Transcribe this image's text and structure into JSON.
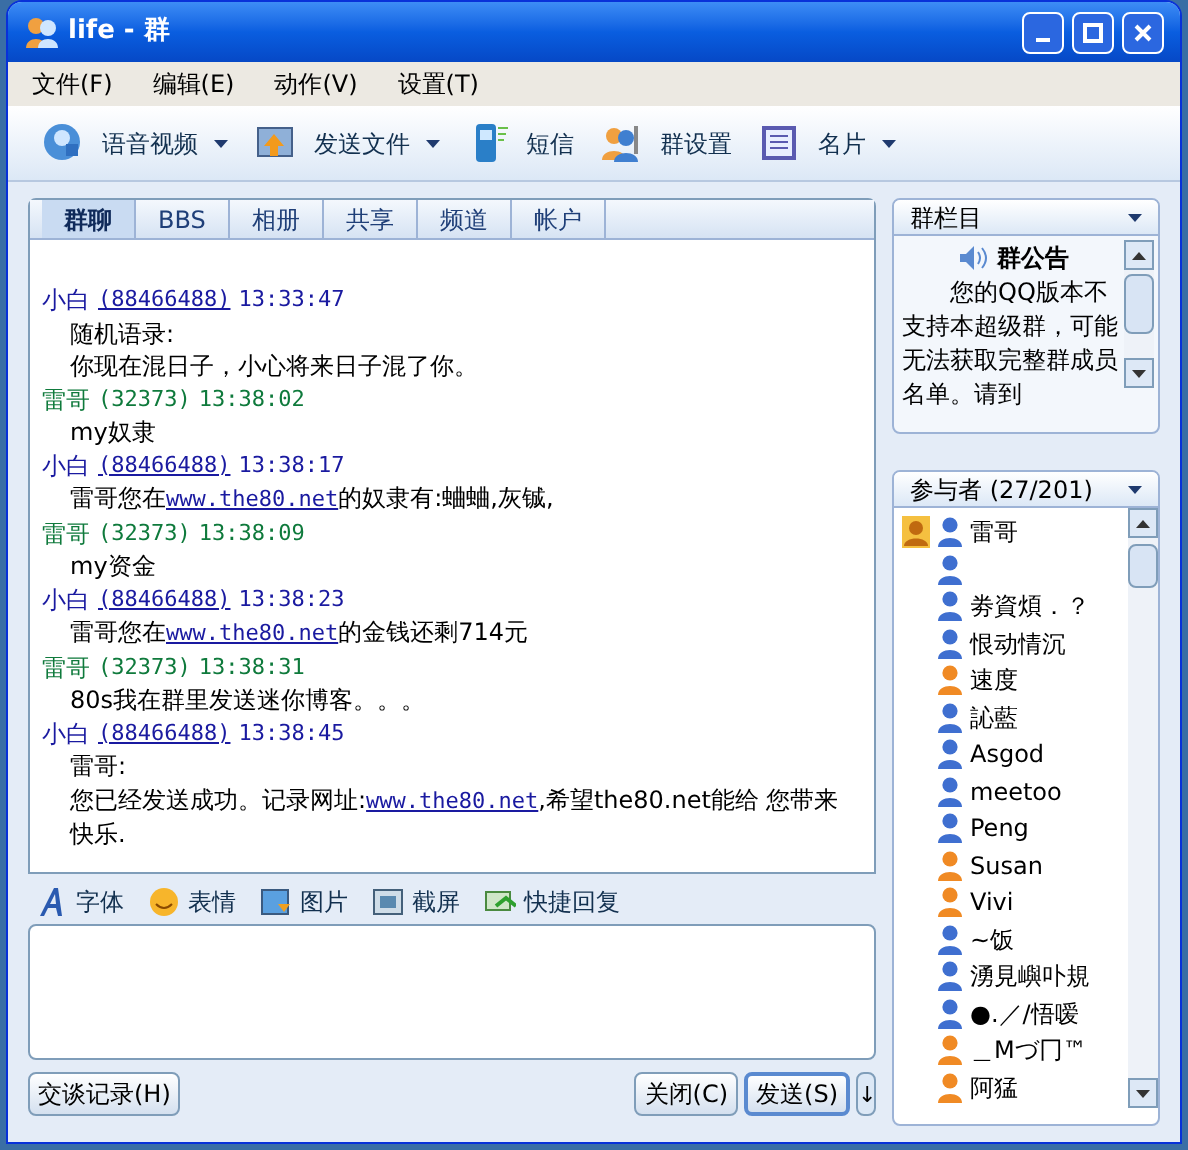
{
  "window": {
    "title": "life - 群"
  },
  "menu": [
    "文件(F)",
    "编辑(E)",
    "动作(V)",
    "设置(T)"
  ],
  "toolbar": [
    {
      "label": "语音视频",
      "kind": "voice",
      "dropdown": true
    },
    {
      "label": "发送文件",
      "kind": "file",
      "dropdown": true
    },
    {
      "label": "短信",
      "kind": "sms",
      "dropdown": false
    },
    {
      "label": "群设置",
      "kind": "settings",
      "dropdown": false
    },
    {
      "label": "名片",
      "kind": "card",
      "dropdown": true
    }
  ],
  "tabs": [
    {
      "label": "群聊",
      "selected": true
    },
    {
      "label": "BBS",
      "selected": false
    },
    {
      "label": "相册",
      "selected": false
    },
    {
      "label": "共享",
      "selected": false
    },
    {
      "label": "频道",
      "selected": false
    },
    {
      "label": "帐户",
      "selected": false
    }
  ],
  "messages": [
    {
      "sender": "小白",
      "id": "(88466488)",
      "id_link": true,
      "time": "13:33:47",
      "color": "#1a1aa0",
      "lines": [
        [
          {
            "kind": "text",
            "text": "随机语录:"
          }
        ],
        [
          {
            "kind": "text",
            "text": "你现在混日子，小心将来日子混了你。"
          }
        ]
      ]
    },
    {
      "sender": "雷哥",
      "id": "(32373)",
      "id_link": false,
      "time": "13:38:02",
      "color": "#0f7a3c",
      "lines": [
        [
          {
            "kind": "text",
            "text": "my奴隶"
          }
        ]
      ]
    },
    {
      "sender": "小白",
      "id": "(88466488)",
      "id_link": true,
      "time": "13:38:17",
      "color": "#1a1aa0",
      "lines": [
        [
          {
            "kind": "text",
            "text": "雷哥您在"
          },
          {
            "kind": "link",
            "text": "www.the80.net"
          },
          {
            "kind": "text",
            "text": "的奴隶有:蛐蛐,灰铖,"
          }
        ]
      ]
    },
    {
      "sender": "雷哥",
      "id": "(32373)",
      "id_link": false,
      "time": "13:38:09",
      "color": "#0f7a3c",
      "lines": [
        [
          {
            "kind": "text",
            "text": "my资金"
          }
        ]
      ]
    },
    {
      "sender": "小白",
      "id": "(88466488)",
      "id_link": true,
      "time": "13:38:23",
      "color": "#1a1aa0",
      "lines": [
        [
          {
            "kind": "text",
            "text": "雷哥您在"
          },
          {
            "kind": "link",
            "text": "www.the80.net"
          },
          {
            "kind": "text",
            "text": "的金钱还剩714元"
          }
        ]
      ]
    },
    {
      "sender": "雷哥",
      "id": "(32373)",
      "id_link": false,
      "time": "13:38:31",
      "color": "#0f7a3c",
      "lines": [
        [
          {
            "kind": "text",
            "text": "80s我在群里发送迷你博客。。。"
          }
        ]
      ]
    },
    {
      "sender": "小白",
      "id": "(88466488)",
      "id_link": true,
      "time": "13:38:45",
      "color": "#1a1aa0",
      "lines": [
        [
          {
            "kind": "text",
            "text": "雷哥:"
          }
        ],
        [
          {
            "kind": "text",
            "text": "您已经发送成功。记录网址:"
          },
          {
            "kind": "link",
            "text": "www.the80.net"
          },
          {
            "kind": "text",
            "text": ",希望the80.net能给 您带来快乐."
          }
        ]
      ]
    }
  ],
  "input_toolbar": [
    {
      "label": "字体",
      "kind": "font"
    },
    {
      "label": "表情",
      "kind": "smiley"
    },
    {
      "label": "图片",
      "kind": "image"
    },
    {
      "label": "截屏",
      "kind": "screenshot"
    },
    {
      "label": "快捷回复",
      "kind": "reply"
    }
  ],
  "history_button": "交谈记录(H)",
  "close_button": "关闭(C)",
  "send_button": "发送(S)",
  "send_menu": "↓",
  "group_panel": {
    "title": "群栏目",
    "notice_title": "群公告",
    "notice_text": "　　您的QQ版本不支持本超级群，可能无法获取完整群成员名单。请到"
  },
  "members_panel": {
    "title": "参与者 (27/201)",
    "members": [
      {
        "name": "雷哥",
        "color": "#3f6fd0",
        "owner": true
      },
      {
        "color": "#3f6fd0",
        "owner": false
      },
      {
        "name": "劵資煩．？",
        "color": "#3f6fd0",
        "owner": false
      },
      {
        "name": "恨动情沉",
        "color": "#3f6fd0",
        "owner": false
      },
      {
        "name": "速度",
        "color": "#f08a24",
        "owner": false
      },
      {
        "name": "訫藍",
        "color": "#3f6fd0",
        "owner": false
      },
      {
        "name": "Asgod",
        "color": "#3f6fd0",
        "owner": false
      },
      {
        "name": "meetoo",
        "color": "#3f6fd0",
        "owner": false
      },
      {
        "name": "Peng",
        "color": "#3f6fd0",
        "owner": false
      },
      {
        "name": "Susan",
        "color": "#f08a24",
        "owner": false
      },
      {
        "name": "Vivi",
        "color": "#f08a24",
        "owner": false
      },
      {
        "name": "~饭",
        "color": "#3f6fd0",
        "owner": false
      },
      {
        "name": "湧見嶼卟規",
        "color": "#3f6fd0",
        "owner": false
      },
      {
        "name": "●.／/悟嗳",
        "color": "#3f6fd0",
        "owner": false
      },
      {
        "name": "＿Мづ冂™",
        "color": "#f08a24",
        "owner": false
      },
      {
        "name": "阿猛",
        "color": "#f08a24",
        "owner": false
      }
    ]
  }
}
